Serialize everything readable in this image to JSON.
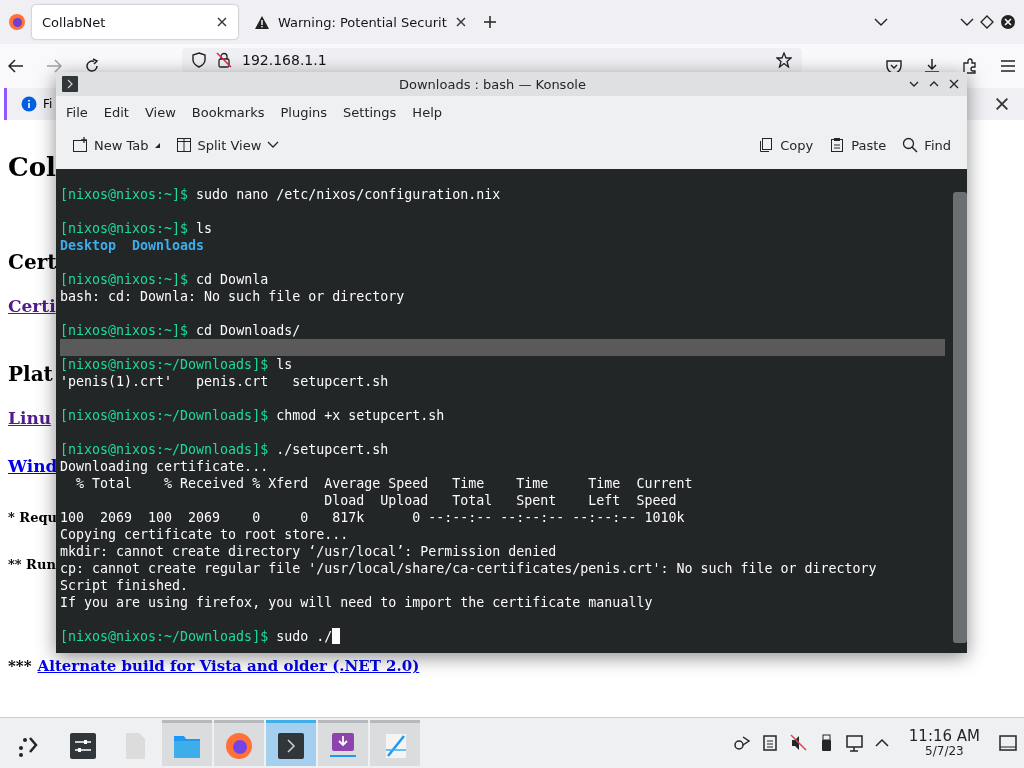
{
  "browser": {
    "tabs": [
      {
        "label": "CollabNet",
        "selected": true
      },
      {
        "label": "Warning: Potential Securit",
        "selected": false
      }
    ],
    "url": "192.168.1.1",
    "forward_disabled": true,
    "notification": {
      "text": "Fi"
    },
    "page": [
      {
        "kind": "h1",
        "text": "Col"
      },
      {
        "kind": "h2",
        "text": "Cert"
      },
      {
        "kind": "link",
        "text": "Certi",
        "visited": true
      },
      {
        "kind": "h2",
        "text": "Plat"
      },
      {
        "kind": "link",
        "text": "Linu",
        "visited": true
      },
      {
        "kind": "link",
        "text": "Wind",
        "visited": false
      },
      {
        "kind": "note",
        "text": "* Requ"
      },
      {
        "kind": "note",
        "text": "** Run"
      },
      {
        "kind": "note_link",
        "prefix": "***",
        "link": "Alternate build for Vista and older (.NET 2.0)"
      }
    ]
  },
  "konsole": {
    "title": "Downloads : bash — Konsole",
    "menu": [
      "File",
      "Edit",
      "View",
      "Bookmarks",
      "Plugins",
      "Settings",
      "Help"
    ],
    "toolbar_left": [
      {
        "kind": "new-tab",
        "label": "New Tab"
      },
      {
        "kind": "split-view",
        "label": "Split View"
      }
    ],
    "toolbar_right": [
      {
        "kind": "copy",
        "label": "Copy"
      },
      {
        "kind": "paste",
        "label": "Paste"
      },
      {
        "kind": "find",
        "label": "Find"
      }
    ],
    "lines": [
      {
        "kind": "prompt",
        "prompt": "[nixos@nixos:~]$",
        "command": "sudo nano /etc/nixos/configuration.nix",
        "cursor": false
      },
      {
        "kind": "blank"
      },
      {
        "kind": "prompt",
        "prompt": "[nixos@nixos:~]$",
        "command": "ls",
        "cursor": false
      },
      {
        "kind": "listing",
        "items": [
          "Desktop",
          "Downloads"
        ]
      },
      {
        "kind": "blank"
      },
      {
        "kind": "prompt",
        "prompt": "[nixos@nixos:~]$",
        "command": "cd Downla",
        "cursor": false
      },
      {
        "kind": "output",
        "text": "bash: cd: Downla: No such file or directory"
      },
      {
        "kind": "blank"
      },
      {
        "kind": "prompt",
        "prompt": "[nixos@nixos:~]$",
        "command": "cd Downloads/",
        "cursor": false
      },
      {
        "kind": "selection"
      },
      {
        "kind": "prompt",
        "prompt": "[nixos@nixos:~/Downloads]$",
        "command": "ls",
        "cursor": false
      },
      {
        "kind": "output",
        "text": "'penis(1).crt'   penis.crt   setupcert.sh"
      },
      {
        "kind": "blank"
      },
      {
        "kind": "prompt",
        "prompt": "[nixos@nixos:~/Downloads]$",
        "command": "chmod +x setupcert.sh",
        "cursor": false
      },
      {
        "kind": "blank"
      },
      {
        "kind": "prompt",
        "prompt": "[nixos@nixos:~/Downloads]$",
        "command": "./setupcert.sh",
        "cursor": false
      },
      {
        "kind": "output",
        "text": "Downloading certificate..."
      },
      {
        "kind": "output",
        "text": "  % Total    % Received % Xferd  Average Speed   Time    Time     Time  Current"
      },
      {
        "kind": "output",
        "text": "                                 Dload  Upload   Total   Spent    Left  Speed"
      },
      {
        "kind": "output",
        "text": "100  2069  100  2069    0     0   817k      0 --:--:-- --:--:-- --:--:-- 1010k"
      },
      {
        "kind": "output",
        "text": "Copying certificate to root store..."
      },
      {
        "kind": "output",
        "text": "mkdir: cannot create directory ‘/usr/local’: Permission denied"
      },
      {
        "kind": "output",
        "text": "cp: cannot create regular file '/usr/local/share/ca-certificates/penis.crt': No such file or directory"
      },
      {
        "kind": "output",
        "text": "Script finished."
      },
      {
        "kind": "output",
        "text": "If you are using firefox, you will need to import the certificate manually"
      },
      {
        "kind": "blank"
      },
      {
        "kind": "prompt",
        "prompt": "[nixos@nixos:~/Downloads]$",
        "command": "sudo ./",
        "cursor": true
      }
    ]
  },
  "taskbar": {
    "tasks": [
      {
        "kind": "launcher",
        "running": false,
        "active": false
      },
      {
        "kind": "settings",
        "running": false,
        "active": false
      },
      {
        "kind": "file",
        "running": false,
        "active": false
      },
      {
        "kind": "folder",
        "running": true,
        "active": false
      },
      {
        "kind": "browser",
        "running": true,
        "active": false
      },
      {
        "kind": "terminal",
        "running": true,
        "active": true
      },
      {
        "kind": "download",
        "running": true,
        "active": false
      },
      {
        "kind": "editor",
        "running": true,
        "active": false
      }
    ],
    "time": "11:16 AM",
    "date": "5/7/23"
  }
}
